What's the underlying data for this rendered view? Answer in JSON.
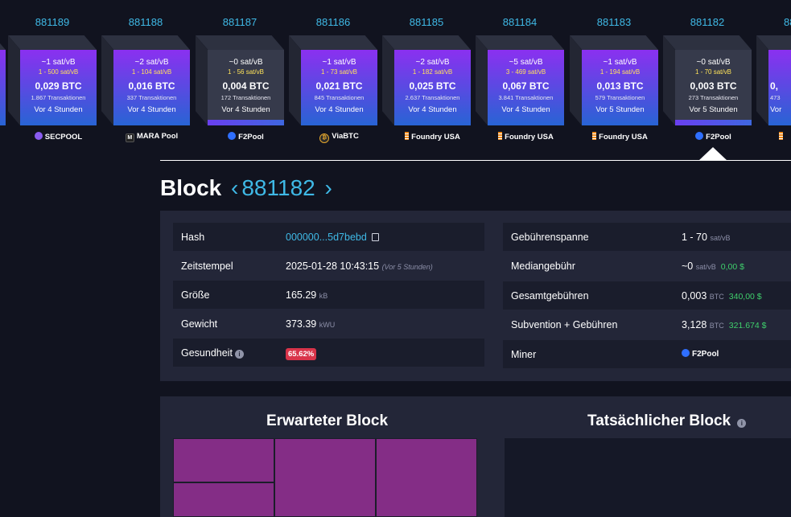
{
  "blocks": [
    {
      "height": "",
      "fee_median": "",
      "fee_range": "",
      "size": "",
      "txs": "",
      "time": "",
      "pool": "",
      "pool_icon": "",
      "style": "purple"
    },
    {
      "height": "881189",
      "fee_median": "~1 sat/vB",
      "fee_range": "1 - 500 sat/vB",
      "size": "0,029 BTC",
      "txs": "1.867 Transaktionen",
      "time": "Vor 4 Stunden",
      "pool": "SECPOOL",
      "pool_icon": "secpool-icon",
      "style": "purple"
    },
    {
      "height": "881188",
      "fee_median": "~2 sat/vB",
      "fee_range": "1 - 104 sat/vB",
      "size": "0,016 BTC",
      "txs": "337 Transaktionen",
      "time": "Vor 4 Stunden",
      "pool": "MARA Pool",
      "pool_icon": "mara-icon",
      "style": "purple"
    },
    {
      "height": "881187",
      "fee_median": "~0 sat/vB",
      "fee_range": "1 - 56 sat/vB",
      "size": "0,004 BTC",
      "txs": "172 Transaktionen",
      "time": "Vor 4 Stunden",
      "pool": "F2Pool",
      "pool_icon": "f2pool-icon",
      "style": "gray"
    },
    {
      "height": "881186",
      "fee_median": "~1 sat/vB",
      "fee_range": "1 - 73 sat/vB",
      "size": "0,021 BTC",
      "txs": "845 Transaktionen",
      "time": "Vor 4 Stunden",
      "pool": "ViaBTC",
      "pool_icon": "viabtc-icon",
      "style": "purple"
    },
    {
      "height": "881185",
      "fee_median": "~2 sat/vB",
      "fee_range": "1 - 182 sat/vB",
      "size": "0,025 BTC",
      "txs": "2.637 Transaktionen",
      "time": "Vor 4 Stunden",
      "pool": "Foundry USA",
      "pool_icon": "foundry-icon",
      "style": "purple"
    },
    {
      "height": "881184",
      "fee_median": "~5 sat/vB",
      "fee_range": "3 - 469 sat/vB",
      "size": "0,067 BTC",
      "txs": "3.841 Transaktionen",
      "time": "Vor 4 Stunden",
      "pool": "Foundry USA",
      "pool_icon": "foundry-icon",
      "style": "purple"
    },
    {
      "height": "881183",
      "fee_median": "~1 sat/vB",
      "fee_range": "1 - 194 sat/vB",
      "size": "0,013 BTC",
      "txs": "579 Transaktionen",
      "time": "Vor 5 Stunden",
      "pool": "Foundry USA",
      "pool_icon": "foundry-icon",
      "style": "purple"
    },
    {
      "height": "881182",
      "fee_median": "~0 sat/vB",
      "fee_range": "1 - 70 sat/vB",
      "size": "0,003 BTC",
      "txs": "273 Transaktionen",
      "time": "Vor 5 Stunden",
      "pool": "F2Pool",
      "pool_icon": "f2pool-icon",
      "style": "gray"
    },
    {
      "height": "881181",
      "fee_median": "",
      "fee_range": "",
      "size": "0,",
      "txs": "473",
      "time": "Vor",
      "pool": "",
      "pool_icon": "foundry-icon",
      "style": "purple"
    }
  ],
  "header": {
    "title": "Block",
    "prev": "‹",
    "next": "›",
    "height": "881182"
  },
  "details": {
    "hash": {
      "label": "Hash",
      "value": "000000...5d7bebd"
    },
    "timestamp": {
      "label": "Zeitstempel",
      "value": "2025-01-28 10:43:15",
      "relative": "(Vor 5 Stunden)"
    },
    "size": {
      "label": "Größe",
      "value": "165.29",
      "unit": "kB"
    },
    "weight": {
      "label": "Gewicht",
      "value": "373.39",
      "unit": "kWU"
    },
    "health": {
      "label": "Gesundheit",
      "value": "65.62%"
    },
    "fee_span": {
      "label": "Gebührenspanne",
      "value": "1 - 70",
      "unit": "sat/vB"
    },
    "median_fee": {
      "label": "Mediangebühr",
      "value": "~0",
      "unit": "sat/vB",
      "fiat": "0,00 $"
    },
    "total_fees": {
      "label": "Gesamtgebühren",
      "value": "0,003",
      "unit": "BTC",
      "fiat": "340,00 $"
    },
    "subsidy": {
      "label": "Subvention + Gebühren",
      "value": "3,128",
      "unit": "BTC",
      "fiat": "321.674 $"
    },
    "miner": {
      "label": "Miner",
      "value": "F2Pool"
    }
  },
  "overview": {
    "expected": "Erwarteter Block",
    "actual": "Tatsächlicher Block"
  },
  "colors": {
    "accent": "#3fb9e6",
    "fiat": "#3fcf6c",
    "health_badge": "#d9344a",
    "tx_tile": "#842d86"
  }
}
